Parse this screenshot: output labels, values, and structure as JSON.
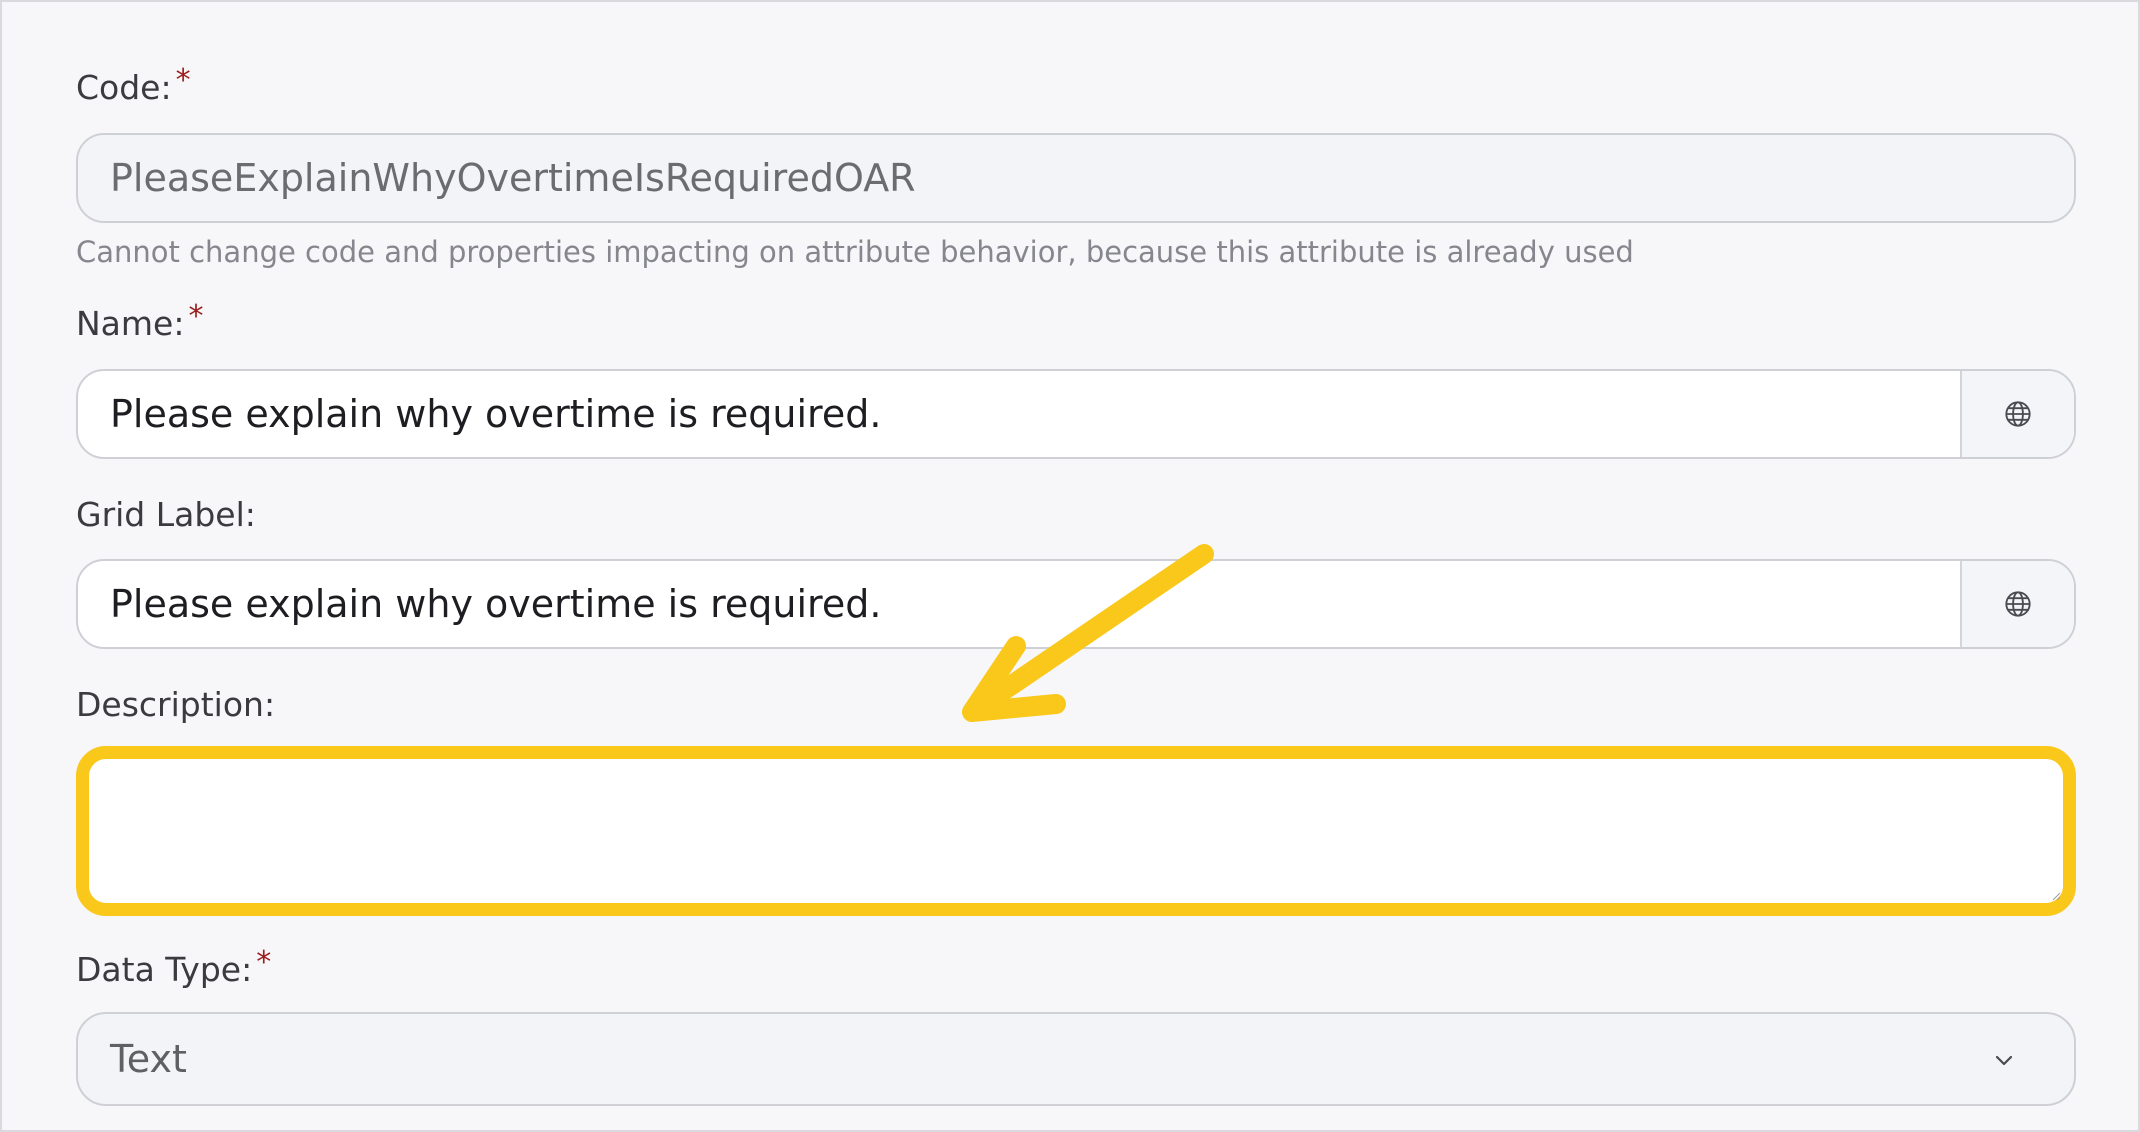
{
  "form": {
    "code": {
      "label": "Code:",
      "required_mark": "*",
      "value": "PleaseExplainWhyOvertimeIsRequiredOAR",
      "hint": "Cannot change code and properties impacting on attribute behavior, because this attribute is already used"
    },
    "name": {
      "label": "Name:",
      "required_mark": "*",
      "value": "Please explain why overtime is required.",
      "addon_icon": "globe-icon"
    },
    "grid_label": {
      "label": "Grid Label:",
      "value": "Please explain why overtime is required.",
      "addon_icon": "globe-icon"
    },
    "description": {
      "label": "Description:",
      "value": ""
    },
    "data_type": {
      "label": "Data Type:",
      "required_mark": "*",
      "selected": "Text",
      "icon": "chevron-down-icon"
    }
  },
  "annotation": {
    "icon": "arrow-icon",
    "color": "#f9c81b"
  }
}
